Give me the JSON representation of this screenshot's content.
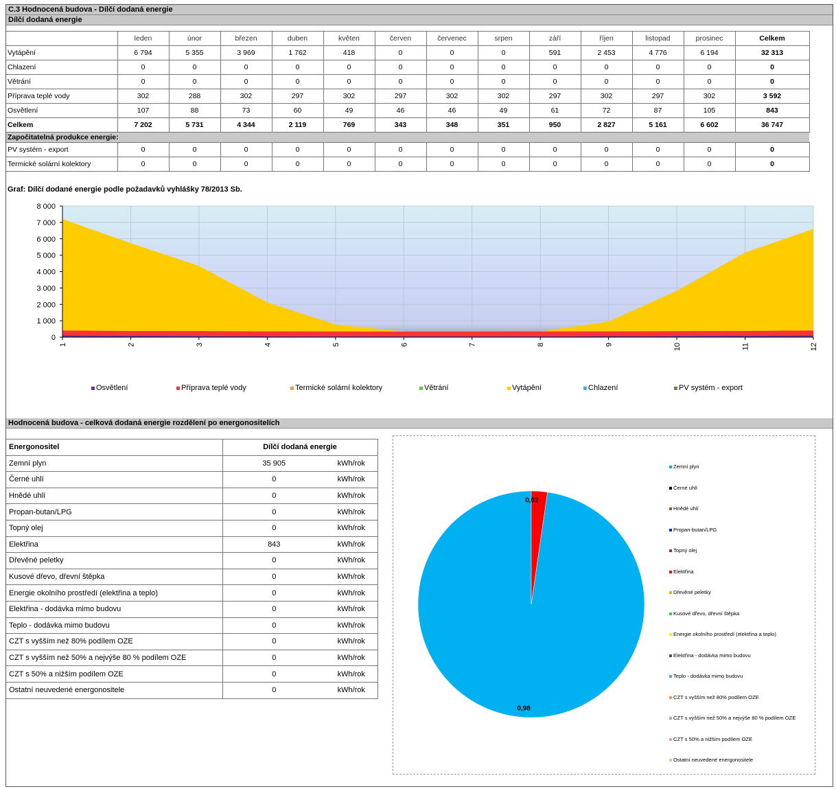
{
  "section_title": "C.3 Hodnocená budova - Dílčí dodaná energie",
  "subsection_title": "Dílčí dodaná energie",
  "months": [
    "leden",
    "únor",
    "březen",
    "duben",
    "květen",
    "červen",
    "červenec",
    "srpen",
    "září",
    "říjen",
    "listopad",
    "prosinec"
  ],
  "total_header": "Celkem",
  "rows": [
    {
      "label": "Vytápění",
      "values": [
        "6 794",
        "5 355",
        "3 969",
        "1 762",
        "418",
        "0",
        "0",
        "0",
        "591",
        "2 453",
        "4 776",
        "6 194"
      ],
      "total": "32 313"
    },
    {
      "label": "Chlazení",
      "values": [
        "0",
        "0",
        "0",
        "0",
        "0",
        "0",
        "0",
        "0",
        "0",
        "0",
        "0",
        "0"
      ],
      "total": "0"
    },
    {
      "label": "Větrání",
      "values": [
        "0",
        "0",
        "0",
        "0",
        "0",
        "0",
        "0",
        "0",
        "0",
        "0",
        "0",
        "0"
      ],
      "total": "0"
    },
    {
      "label": "Příprava teplé vody",
      "values": [
        "302",
        "288",
        "302",
        "297",
        "302",
        "297",
        "302",
        "302",
        "297",
        "302",
        "297",
        "302"
      ],
      "total": "3 592"
    },
    {
      "label": "Osvětlení",
      "values": [
        "107",
        "88",
        "73",
        "60",
        "49",
        "46",
        "46",
        "49",
        "61",
        "72",
        "87",
        "105"
      ],
      "total": "843"
    }
  ],
  "total_row": {
    "label": "Celkem",
    "values": [
      "7 202",
      "5 731",
      "4 344",
      "2 119",
      "769",
      "343",
      "348",
      "351",
      "950",
      "2 827",
      "5 161",
      "6 602"
    ],
    "total": "36 747"
  },
  "production_title": "Započitatelná produkce energie:",
  "production_rows": [
    {
      "label": "PV systém - export",
      "values": [
        "0",
        "0",
        "0",
        "0",
        "0",
        "0",
        "0",
        "0",
        "0",
        "0",
        "0",
        "0"
      ],
      "total": "0"
    },
    {
      "label": "Termické solární kolektory",
      "values": [
        "0",
        "0",
        "0",
        "0",
        "0",
        "0",
        "0",
        "0",
        "0",
        "0",
        "0",
        "0"
      ],
      "total": "0"
    }
  ],
  "chart_title": "Graf: Dílčí dodané energie podle požadavků vyhlášky 78/2013 Sb.",
  "chart_data": [
    {
      "type": "area",
      "x": [
        1,
        2,
        3,
        4,
        5,
        6,
        7,
        8,
        9,
        10,
        11,
        12
      ],
      "ylim": [
        0,
        8000
      ],
      "yticks": [
        "0",
        "1 000",
        "2 000",
        "3 000",
        "4 000",
        "5 000",
        "6 000",
        "7 000",
        "8 000"
      ],
      "series": [
        {
          "name": "Osvětlení",
          "color": "#7030a0",
          "values": [
            107,
            88,
            73,
            60,
            49,
            46,
            46,
            49,
            61,
            72,
            87,
            105
          ]
        },
        {
          "name": "Příprava teplé vody",
          "color": "#ff3333",
          "values": [
            302,
            288,
            302,
            297,
            302,
            297,
            302,
            302,
            297,
            302,
            297,
            302
          ]
        },
        {
          "name": "Termické solární kolektory",
          "color": "#f79646",
          "values": [
            0,
            0,
            0,
            0,
            0,
            0,
            0,
            0,
            0,
            0,
            0,
            0
          ]
        },
        {
          "name": "Větrání",
          "color": "#66cc33",
          "values": [
            0,
            0,
            0,
            0,
            0,
            0,
            0,
            0,
            0,
            0,
            0,
            0
          ]
        },
        {
          "name": "Vytápění",
          "color": "#ffcc00",
          "values": [
            6794,
            5355,
            3969,
            1762,
            418,
            0,
            0,
            0,
            591,
            2453,
            4776,
            6194
          ]
        },
        {
          "name": "Chlazení",
          "color": "#33b5e5",
          "values": [
            0,
            0,
            0,
            0,
            0,
            0,
            0,
            0,
            0,
            0,
            0,
            0
          ]
        },
        {
          "name": "PV systém - export",
          "color": "#808040",
          "values": [
            0,
            0,
            0,
            0,
            0,
            0,
            0,
            0,
            0,
            0,
            0,
            0
          ]
        }
      ],
      "grid": true,
      "legend": "bottom"
    },
    {
      "type": "pie",
      "slices": [
        {
          "name": "Zemní plyn",
          "value": 35905,
          "label": "0,98",
          "color": "#00b0f0"
        },
        {
          "name": "Elektřina",
          "value": 843,
          "label": "0,02",
          "color": "#ff0000"
        }
      ],
      "legend": "right"
    }
  ],
  "section2_title": "Hodnocená budova - celková dodaná energie rozdělení po energonositelích",
  "energy_headers": {
    "carrier": "Energonositel",
    "value": "Dílčí dodaná energie"
  },
  "energy_rows": [
    {
      "label": "Zemní plyn",
      "value": "35 905",
      "unit": "kWh/rok"
    },
    {
      "label": "Černé uhlí",
      "value": "0",
      "unit": "kWh/rok"
    },
    {
      "label": "Hnědé uhlí",
      "value": "0",
      "unit": "kWh/rok"
    },
    {
      "label": "Propan-butan/LPG",
      "value": "0",
      "unit": "kWh/rok"
    },
    {
      "label": "Topný olej",
      "value": "0",
      "unit": "kWh/rok"
    },
    {
      "label": "Elektřina",
      "value": "843",
      "unit": "kWh/rok"
    },
    {
      "label": "Dřevěné peletky",
      "value": "0",
      "unit": "kWh/rok"
    },
    {
      "label": "Kusové dřevo, dřevní štěpka",
      "value": "0",
      "unit": "kWh/rok"
    },
    {
      "label": "Energie okolního prostředí (elektřina a teplo)",
      "value": "0",
      "unit": "kWh/rok"
    },
    {
      "label": "Elektřina - dodávka mimo budovu",
      "value": "0",
      "unit": "kWh/rok"
    },
    {
      "label": "Teplo - dodávka mimo budovu",
      "value": "0",
      "unit": "kWh/rok"
    },
    {
      "label": "CZT s vyšším než 80% podílem OZE",
      "value": "0",
      "unit": "kWh/rok"
    },
    {
      "label": "CZT  s vyšším než 50% a nejvýše 80 % podílem OZE",
      "value": "0",
      "unit": "kWh/rok"
    },
    {
      "label": "CZT s 50% a nižším podílem OZE",
      "value": "0",
      "unit": "kWh/rok"
    },
    {
      "label": "Ostatní neuvedené energonositele",
      "value": "0",
      "unit": "kWh/rok"
    }
  ],
  "pie_legend": [
    {
      "name": "Zemní plyn",
      "color": "#00b0f0"
    },
    {
      "name": "Černé uhlí",
      "color": "#000000"
    },
    {
      "name": "Hnědé uhlí",
      "color": "#8b5a2b"
    },
    {
      "name": "Propan-butan/LPG",
      "color": "#0033cc"
    },
    {
      "name": "Topný olej",
      "color": "#993333"
    },
    {
      "name": "Elektřina",
      "color": "#ff0000"
    },
    {
      "name": "Dřevěné peletky",
      "color": "#ffaa00"
    },
    {
      "name": "Kusové dřevo, dřevní štěpka",
      "color": "#33cc33"
    },
    {
      "name": "Energie okolního prostředí (elektřina a teplo)",
      "color": "#ffee00"
    },
    {
      "name": "Elektřina - dodávka mimo budovu",
      "color": "#7030a0"
    },
    {
      "name": "Teplo - dodávka mimo budovu",
      "color": "#4bacc6"
    },
    {
      "name": "CZT s vyšším než 80% podílem OZE",
      "color": "#f79646"
    },
    {
      "name": "CZT  s vyšším než 50% a nejvýše 80 % podílem OZE",
      "color": "#a6a6d9"
    },
    {
      "name": "CZT s 50% a nižším podílem OZE",
      "color": "#e6a0a0"
    },
    {
      "name": "Ostatní neuvedené energonositele",
      "color": "#c4d79b"
    }
  ]
}
